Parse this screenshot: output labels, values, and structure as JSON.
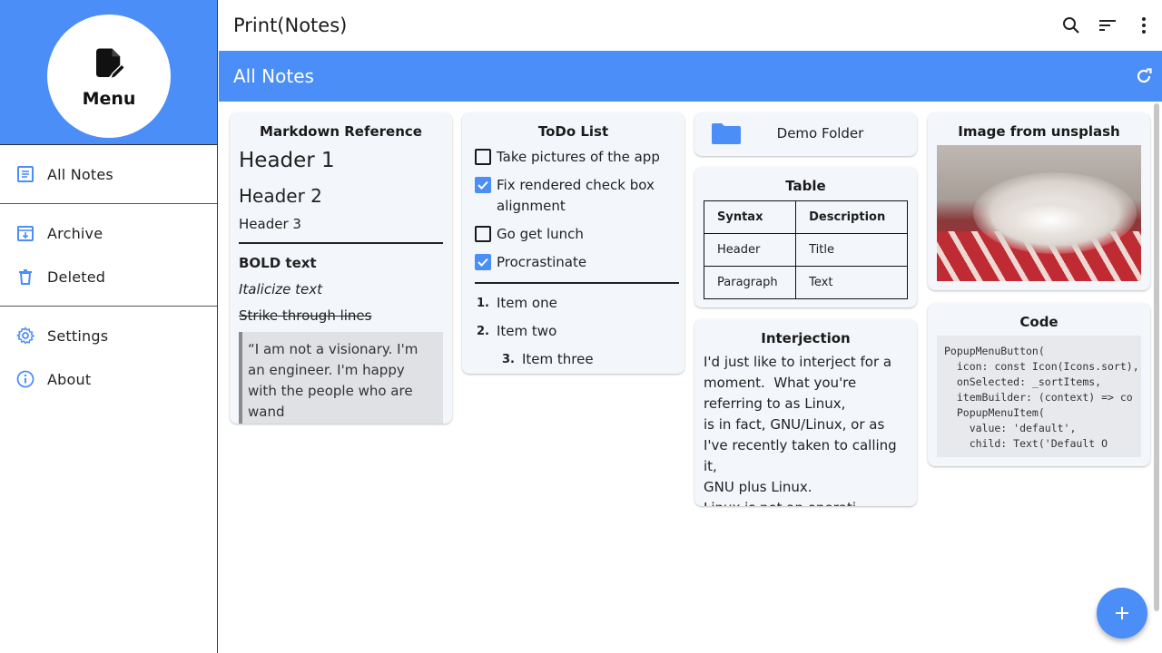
{
  "sidebar": {
    "menu_label": "Menu",
    "items": [
      {
        "label": "All Notes",
        "icon": "note-icon"
      },
      {
        "label": "Archive",
        "icon": "archive-icon"
      },
      {
        "label": "Deleted",
        "icon": "trash-icon"
      },
      {
        "label": "Settings",
        "icon": "gear-icon"
      },
      {
        "label": "About",
        "icon": "info-icon"
      }
    ]
  },
  "topbar": {
    "title": "Print(Notes)",
    "icons": [
      "search-icon",
      "sort-icon",
      "more-vert-icon"
    ]
  },
  "subbar": {
    "title": "All Notes",
    "icon": "refresh-icon"
  },
  "colors": {
    "accent": "#4b8ef7",
    "card_bg": "#f3f6fb"
  },
  "notes": {
    "markdown": {
      "title": "Markdown Reference",
      "h1": "Header 1",
      "h2": "Header 2",
      "h3": "Header 3",
      "bold": "BOLD text",
      "italic": "Italicize text",
      "strike": "Strike through lines",
      "quote": "“I am not a visionary. I'm an engineer. I'm happy with the people who are wand"
    },
    "todo": {
      "title": "ToDo List",
      "items": [
        {
          "text": "Take pictures of the app",
          "checked": false
        },
        {
          "text": "Fix rendered check box alignment",
          "checked": true
        },
        {
          "text": "Go get lunch",
          "checked": false
        },
        {
          "text": "Procrastinate",
          "checked": true
        }
      ],
      "ordered": [
        {
          "num": "1.",
          "text": "Item one"
        },
        {
          "num": "2.",
          "text": "Item two"
        },
        {
          "num": "3.",
          "text": "Item three"
        }
      ]
    },
    "folder": {
      "name": "Demo Folder",
      "icon": "folder-icon"
    },
    "table": {
      "title": "Table",
      "headers": [
        "Syntax",
        "Description"
      ],
      "rows": [
        [
          "Header",
          "Title"
        ],
        [
          "Paragraph",
          "Text"
        ]
      ]
    },
    "interjection": {
      "title": "Interjection",
      "text": "I'd just like to interject for a moment.  What you're referring to as Linux,\nis in fact, GNU/Linux, or as I've recently taken to calling it,\nGNU plus Linux.\nLinux is not an operati"
    },
    "image": {
      "title": "Image from unsplash"
    },
    "code": {
      "title": "Code",
      "text": "PopupMenuButton(\n  icon: const Icon(Icons.sort),\n  onSelected: _sortItems,\n  itemBuilder: (context) => co\n  PopupMenuItem(\n    value: 'default',\n    child: Text('Default O"
    }
  },
  "fab": {
    "icon": "add-icon"
  }
}
